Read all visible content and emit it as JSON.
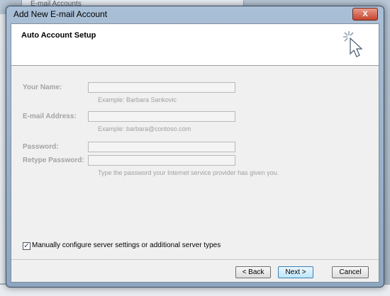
{
  "background": {
    "window_title": "E-mail Accounts"
  },
  "dialog": {
    "title": "Add New E-mail Account",
    "close_label": "X"
  },
  "header": {
    "title": "Auto Account Setup",
    "icon": "cursor-sparkle-icon"
  },
  "form": {
    "name_label": "Your Name:",
    "name_value": "",
    "name_hint": "Example: Barbara Sankovic",
    "email_label": "E-mail Address:",
    "email_value": "",
    "email_hint": "Example: barbara@contoso.com",
    "password_label": "Password:",
    "password_value": "",
    "retype_label": "Retype Password:",
    "retype_value": "",
    "password_hint": "Type the password your Internet service provider has given you."
  },
  "manual_config": {
    "checked": true,
    "label": "Manually configure server settings or additional server types"
  },
  "buttons": {
    "back": "< Back",
    "next": "Next >",
    "cancel": "Cancel"
  }
}
